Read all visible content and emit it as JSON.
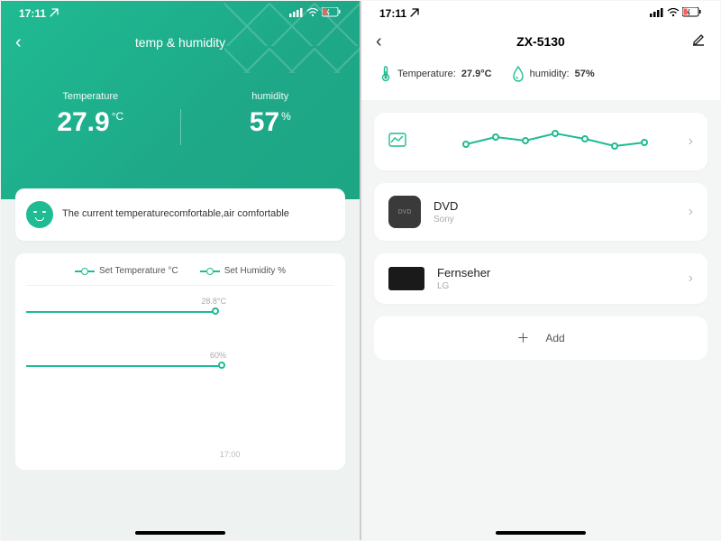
{
  "status_bar": {
    "time": "17:11",
    "location_icon": "↗",
    "signal": "•••",
    "wifi": "wifi",
    "battery": "low-charging"
  },
  "screen1": {
    "title": "temp & humidity",
    "back_glyph": "‹",
    "temp_label": "Temperature",
    "temp_value": "27.9",
    "temp_unit": "°C",
    "humidity_label": "humidity",
    "humidity_value": "57",
    "humidity_unit": "%",
    "comfort_text": "The current temperaturecomfortable,air comfortable",
    "legend_temp": "Set Temperature °C",
    "legend_hum": "Set Humidity %",
    "slider_temp_label": "28.8°C",
    "slider_hum_label": "60%",
    "x_tick": "17:00"
  },
  "screen2": {
    "title": "ZX-5130",
    "back_glyph": "‹",
    "edit_glyph": "✎",
    "temp_label": "Temperature:",
    "temp_value": "27.9°C",
    "hum_label": "humidity:",
    "hum_value": "57%",
    "devices": [
      {
        "name": "DVD",
        "brand": "Sony",
        "icon": "dvd"
      },
      {
        "name": "Fernseher",
        "brand": "LG",
        "icon": "tv"
      }
    ],
    "add_label": "Add",
    "chevron": "›"
  },
  "chart_data": {
    "type": "line",
    "title": "sparkline",
    "x": [
      0,
      1,
      2,
      3,
      4,
      5,
      6
    ],
    "values": [
      18,
      10,
      14,
      6,
      12,
      20,
      16
    ]
  }
}
